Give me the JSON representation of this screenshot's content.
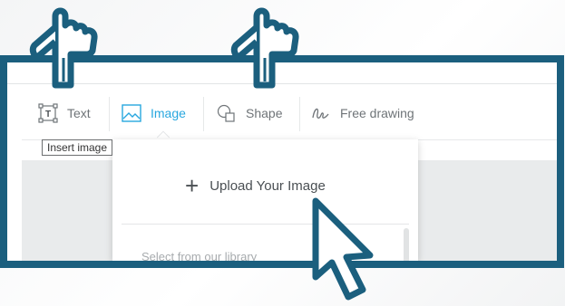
{
  "toolbar": {
    "tools": [
      {
        "label": "Text",
        "icon": "text-box-icon",
        "active": false
      },
      {
        "label": "Image",
        "icon": "image-icon",
        "active": true
      },
      {
        "label": "Shape",
        "icon": "shape-icon",
        "active": false
      },
      {
        "label": "Free drawing",
        "icon": "free-drawing-icon",
        "active": false
      }
    ]
  },
  "image_menu": {
    "upload_label": "Upload Your Image",
    "upload_icon": "plus-icon",
    "tooltip": "Insert image",
    "library_label": "Select from our library"
  },
  "colors": {
    "frame_border": "#1b5f7e",
    "accent": "#28a7df",
    "tool_text": "#6f7478"
  },
  "annotations": [
    "hand-pointer-icon",
    "hand-pointer-icon",
    "arrow-cursor-icon"
  ]
}
